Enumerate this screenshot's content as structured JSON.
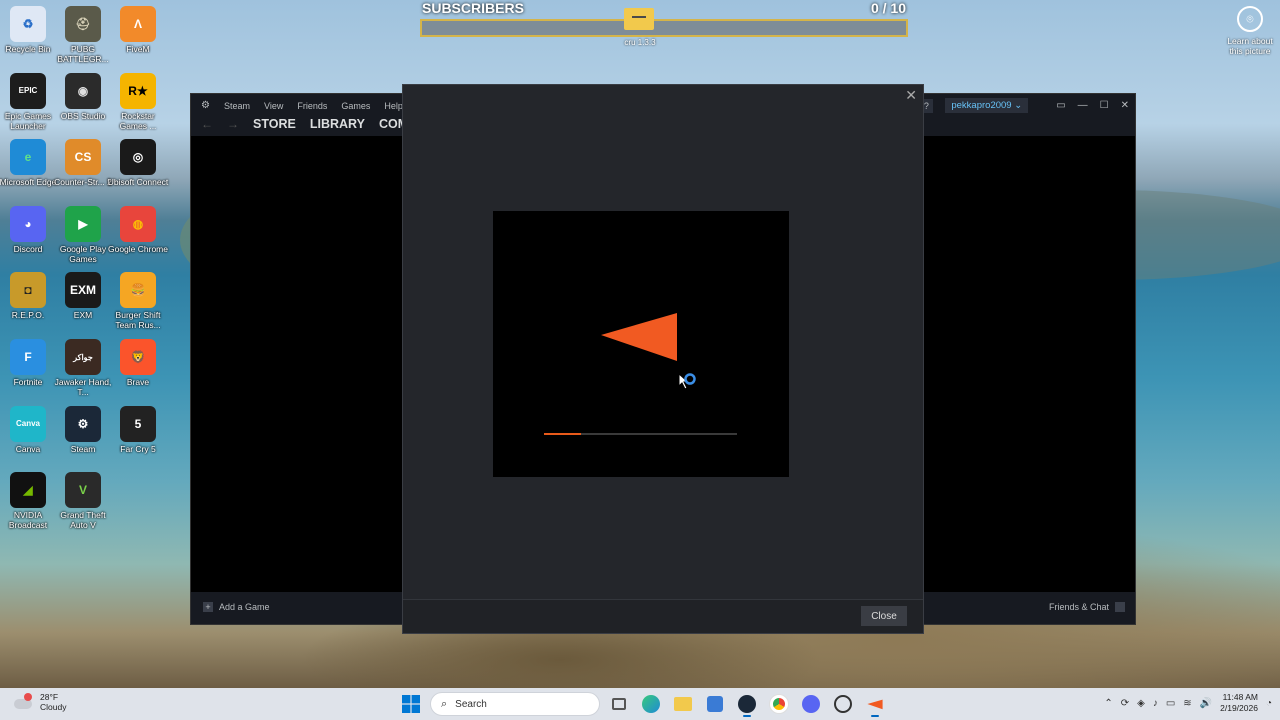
{
  "desktop": {
    "icons": [
      {
        "id": "recycle-bin",
        "label": "Recycle Bin",
        "glyph": "♻",
        "bg": "#dfe8f5",
        "fg": "#2a6fc9"
      },
      {
        "id": "pubg",
        "label": "PUBG BATTLEGR...",
        "glyph": "⛑",
        "bg": "#5a5a4a",
        "fg": "#d8d2b8"
      },
      {
        "id": "fivem",
        "label": "FiveM",
        "glyph": "Λ",
        "bg": "#f28a2a",
        "fg": "#fff"
      },
      {
        "id": "epic-games",
        "label": "Epic Games Launcher",
        "glyph": "EPIC",
        "bg": "#1d1d1d",
        "fg": "#fff"
      },
      {
        "id": "obs-studio",
        "label": "OBS Studio",
        "glyph": "◉",
        "bg": "#2b2b2b",
        "fg": "#e0e0e0"
      },
      {
        "id": "rockstar",
        "label": "Rockstar Games ...",
        "glyph": "R★",
        "bg": "#f5b400",
        "fg": "#000"
      },
      {
        "id": "edge",
        "label": "Microsoft Edge",
        "glyph": "e",
        "bg": "#1f8bd6",
        "fg": "#5fe08a"
      },
      {
        "id": "counter-strike",
        "label": "Counter-Str... 2",
        "glyph": "CS",
        "bg": "#e08b2a",
        "fg": "#fff"
      },
      {
        "id": "ubisoft",
        "label": "Ubisoft Connect",
        "glyph": "◎",
        "bg": "#1a1a1a",
        "fg": "#fff"
      },
      {
        "id": "discord",
        "label": "Discord",
        "glyph": "◕",
        "bg": "#5865f2",
        "fg": "#fff"
      },
      {
        "id": "google-play-games",
        "label": "Google Play Games",
        "glyph": "▶",
        "bg": "#1fa34a",
        "fg": "#fff"
      },
      {
        "id": "chrome",
        "label": "Google Chrome",
        "glyph": "◍",
        "bg": "#e8453c",
        "fg": "#fbbc05"
      },
      {
        "id": "repo",
        "label": "R.E.P.O.",
        "glyph": "◘",
        "bg": "#c89a2a",
        "fg": "#222"
      },
      {
        "id": "exm",
        "label": "EXM",
        "glyph": "EXM",
        "bg": "#1a1a1a",
        "fg": "#fff"
      },
      {
        "id": "burger-shift",
        "label": "Burger Shift Team Rus...",
        "glyph": "🍔",
        "bg": "#f5a623",
        "fg": "#c0392b"
      },
      {
        "id": "fortnite",
        "label": "Fortnite",
        "glyph": "F",
        "bg": "#2a8fe0",
        "fg": "#fff"
      },
      {
        "id": "jawaker",
        "label": "Jawaker Hand, T...",
        "glyph": "جواكر",
        "bg": "#3b2a22",
        "fg": "#fff"
      },
      {
        "id": "brave",
        "label": "Brave",
        "glyph": "🦁",
        "bg": "#fb542b",
        "fg": "#fff"
      },
      {
        "id": "canva",
        "label": "Canva",
        "glyph": "Canva",
        "bg": "#1fb6c9",
        "fg": "#fff"
      },
      {
        "id": "steam",
        "label": "Steam",
        "glyph": "⚙",
        "bg": "#1b2838",
        "fg": "#fff"
      },
      {
        "id": "far-cry-5",
        "label": "Far Cry 5",
        "glyph": "5",
        "bg": "#222",
        "fg": "#fff"
      },
      {
        "id": "nvidia-broadcast",
        "label": "NVIDIA Broadcast",
        "glyph": "◢",
        "bg": "#111",
        "fg": "#76b900"
      },
      {
        "id": "gta-v",
        "label": "Grand Theft Auto V",
        "glyph": "V",
        "bg": "#2a2a2a",
        "fg": "#7ad14a"
      }
    ],
    "learn_label": "Learn about this picture",
    "folder_label": "cru 1.3.3"
  },
  "subscribers": {
    "title": "SUBSCRIBERS",
    "current": "0",
    "separator": " / ",
    "goal": "10",
    "progress": 0
  },
  "steam": {
    "menu": [
      "Steam",
      "View",
      "Friends",
      "Games",
      "Help"
    ],
    "nav": [
      "STORE",
      "LIBRARY",
      "COM"
    ],
    "help_glyph": "?",
    "account": "pekkapro2009",
    "add_game": "Add a Game",
    "friends_chat": "Friends & Chat"
  },
  "dialog": {
    "close_button": "Close",
    "loading_progress": 0.19,
    "logo_color": "#f15a22"
  },
  "taskbar": {
    "temperature": "28°F",
    "condition": "Cloudy",
    "search_placeholder": "Search",
    "time": "11:48 AM",
    "date": "2/19/2026"
  }
}
